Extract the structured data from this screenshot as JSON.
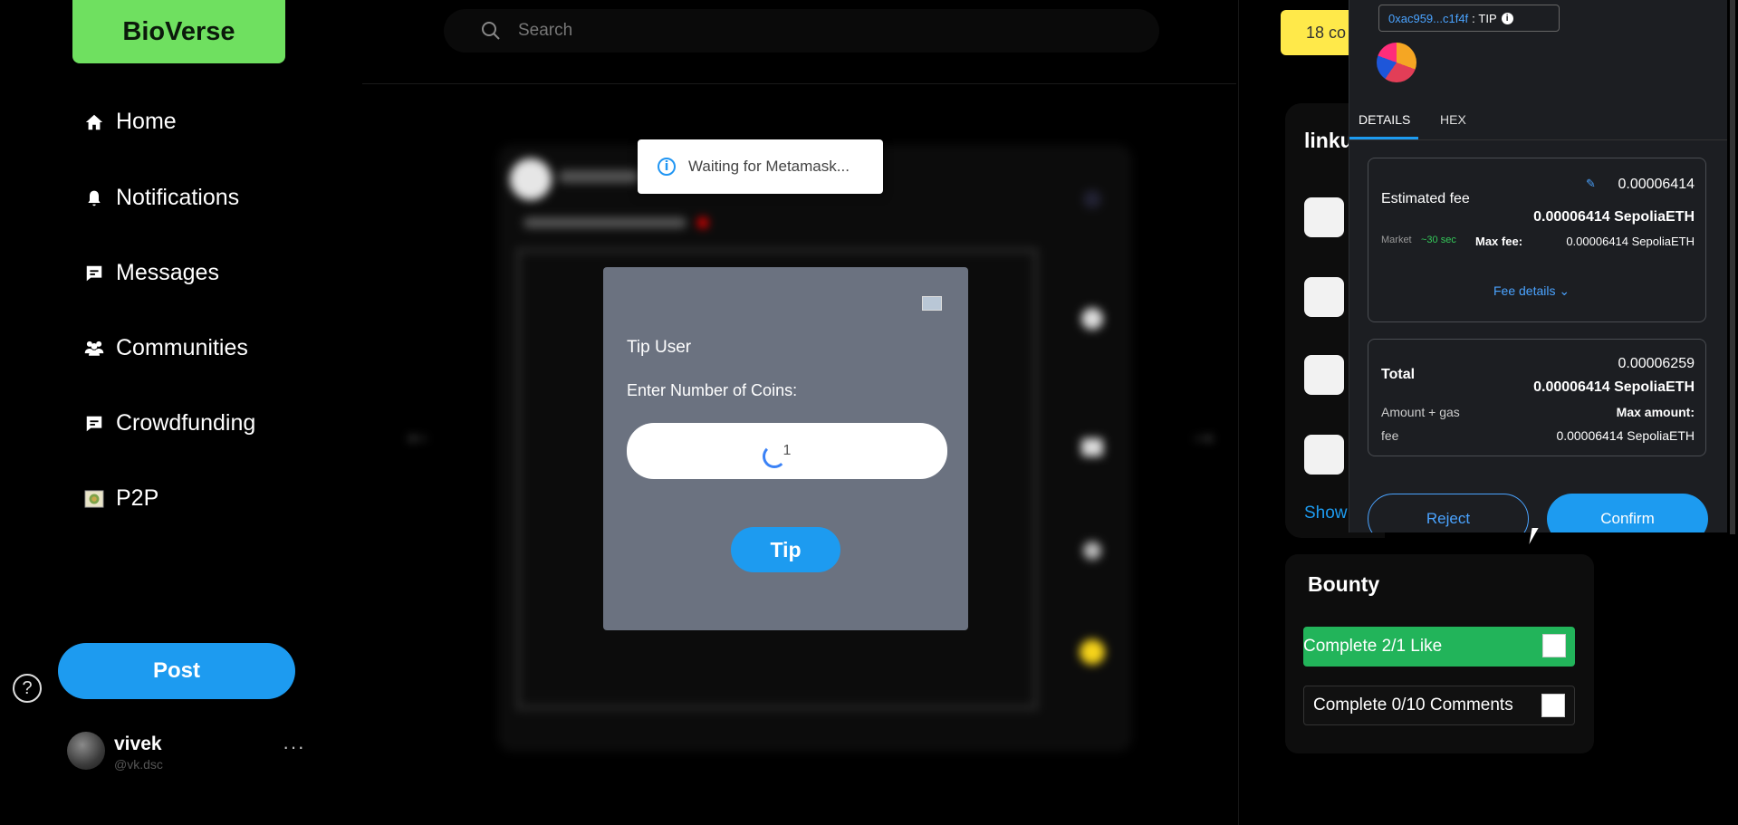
{
  "app": {
    "logo": "BioVerse"
  },
  "sidebar": {
    "items": [
      {
        "label": "Home",
        "icon": "home-icon"
      },
      {
        "label": "Notifications",
        "icon": "bell-icon"
      },
      {
        "label": "Messages",
        "icon": "message-icon"
      },
      {
        "label": "Communities",
        "icon": "users-icon"
      },
      {
        "label": "Crowdfunding",
        "icon": "message-icon"
      },
      {
        "label": "P2P",
        "icon": "p2p-icon"
      }
    ],
    "post_label": "Post",
    "help_icon": "?",
    "user": {
      "name": "vivek",
      "handle": "@vk.dsc",
      "more": "···"
    }
  },
  "search": {
    "placeholder": "Search"
  },
  "toast": {
    "text": "Waiting for Metamask..."
  },
  "tip_modal": {
    "title": "Tip User",
    "label": "Enter Number of Coins:",
    "value": "1",
    "button": "Tip"
  },
  "right": {
    "coins_badge": "18 co",
    "who_title": "linku",
    "show_more": "Show",
    "bounty": {
      "title": "Bounty",
      "items": [
        {
          "label": "Complete 2/1 Like",
          "color": "#22b45a"
        },
        {
          "label": "Complete 0/10 Comments",
          "color": "#111111"
        }
      ]
    }
  },
  "metamask": {
    "account": "0xac959...c1f4f",
    "account_tag": "TIP",
    "tabs": [
      "DETAILS",
      "HEX"
    ],
    "estimated_fee_label": "Estimated fee",
    "fee_edit_value": "0.00006414",
    "fee_eth": "0.00006414 SepoliaETH",
    "market_label": "Market",
    "market_time": "~30 sec",
    "max_fee": "Max fee:",
    "max_fee_value": "0.00006414 SepoliaETH",
    "fee_details": "Fee details",
    "total_label": "Total",
    "total_value": "0.00006259",
    "total_eth": "0.00006414 SepoliaETH",
    "amount_gas_line1": "Amount + gas",
    "amount_gas_line2": "fee",
    "max_amount": "Max amount:",
    "max_amount_value": "0.00006414 SepoliaETH",
    "reject": "Reject",
    "confirm": "Confirm"
  }
}
